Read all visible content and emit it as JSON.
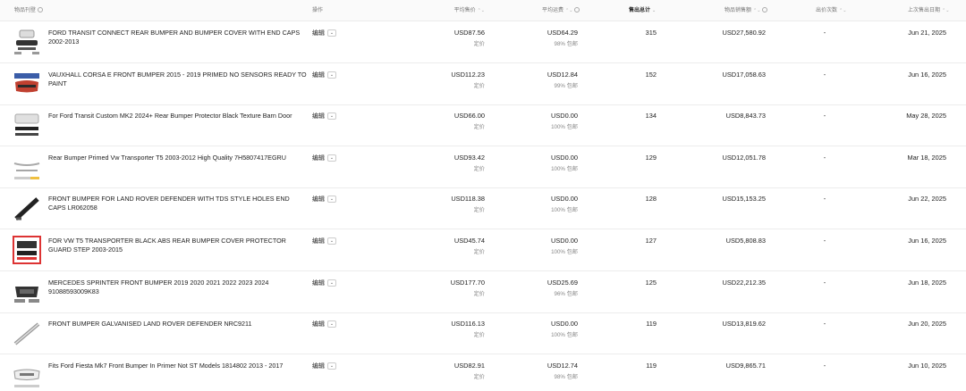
{
  "header": {
    "item": "物品刊登",
    "action": "操作",
    "avg_price": "平均售价",
    "avg_shipping": "平均运费",
    "total_sold": "售出总计",
    "item_sales": "物品销售额",
    "views": "出价次数",
    "last_sold": "上次售出日期",
    "sort_desc_glyph": "⌄",
    "sort_glyph": "⌃⌄"
  },
  "rows": [
    {
      "title": "FORD TRANSIT CONNECT REAR BUMPER AND BUMPER COVER WITH END CAPS 2002-2013",
      "action": "编辑",
      "avg_price": "USD87.56",
      "price_type": "定价",
      "avg_shipping": "USD64.29",
      "shipping_note": "98% 包邮",
      "sold": "315",
      "sales": "USD27,580.92",
      "bids": "-",
      "date": "Jun 21, 2025",
      "thumb": "rear-bumper-cover"
    },
    {
      "title": "VAUXHALL CORSA E FRONT BUMPER 2015 - 2019 PRIMED NO SENSORS READY TO PAINT",
      "action": "编辑",
      "avg_price": "USD112.23",
      "price_type": "定价",
      "avg_shipping": "USD12.84",
      "shipping_note": "99% 包邮",
      "sold": "152",
      "sales": "USD17,058.63",
      "bids": "-",
      "date": "Jun 16, 2025",
      "thumb": "front-bumper-primed"
    },
    {
      "title": "For Ford Transit Custom MK2 2024+ Rear Bumper Protector Black Texture Barn Door",
      "action": "编辑",
      "avg_price": "USD66.00",
      "price_type": "定价",
      "avg_shipping": "USD0.00",
      "shipping_note": "100% 包邮",
      "sold": "134",
      "sales": "USD8,843.73",
      "bids": "-",
      "date": "May 28, 2025",
      "thumb": "bumper-protector"
    },
    {
      "title": "Rear Bumper Primed Vw Transporter T5 2003-2012 High Quality 7H5807417EGRU",
      "action": "编辑",
      "avg_price": "USD93.42",
      "price_type": "定价",
      "avg_shipping": "USD0.00",
      "shipping_note": "100% 包邮",
      "sold": "129",
      "sales": "USD12,051.78",
      "bids": "-",
      "date": "Mar 18, 2025",
      "thumb": "rear-bumper-primed"
    },
    {
      "title": "FRONT BUMPER FOR LAND ROVER DEFENDER WITH TDS STYLE HOLES END CAPS LR062058",
      "action": "编辑",
      "avg_price": "USD118.38",
      "price_type": "定价",
      "avg_shipping": "USD0.00",
      "shipping_note": "100% 包邮",
      "sold": "128",
      "sales": "USD15,153.25",
      "bids": "-",
      "date": "Jun 22, 2025",
      "thumb": "black-bar-bumper"
    },
    {
      "title": "FOR VW T5 TRANSPORTER BLACK ABS REAR BUMPER COVER PROTECTOR GUARD STEP 2003-2015",
      "action": "编辑",
      "avg_price": "USD45.74",
      "price_type": "定价",
      "avg_shipping": "USD0.00",
      "shipping_note": "100% 包邮",
      "sold": "127",
      "sales": "USD5,808.83",
      "bids": "-",
      "date": "Jun 16, 2025",
      "thumb": "red-framed-protector"
    },
    {
      "title": "MERCEDES SPRINTER FRONT BUMPER 2019 2020 2021 2022 2023 2024 91088593009K83",
      "action": "编辑",
      "avg_price": "USD177.70",
      "price_type": "定价",
      "avg_shipping": "USD25.69",
      "shipping_note": "96% 包邮",
      "sold": "125",
      "sales": "USD22,212.35",
      "bids": "-",
      "date": "Jun 18, 2025",
      "thumb": "sprinter-bumper"
    },
    {
      "title": "FRONT BUMPER GALVANISED LAND ROVER DEFENDER NRC9211",
      "action": "编辑",
      "avg_price": "USD116.13",
      "price_type": "定价",
      "avg_shipping": "USD0.00",
      "shipping_note": "100% 包邮",
      "sold": "119",
      "sales": "USD13,819.62",
      "bids": "-",
      "date": "Jun 20, 2025",
      "thumb": "galvanised-bar"
    },
    {
      "title": "Fits Ford Fiesta Mk7 Front Bumper In Primer Not ST Models 1814802 2013 - 2017",
      "action": "编辑",
      "avg_price": "USD82.91",
      "price_type": "定价",
      "avg_shipping": "USD12.74",
      "shipping_note": "98% 包邮",
      "sold": "119",
      "sales": "USD9,865.71",
      "bids": "-",
      "date": "Jun 10, 2025",
      "thumb": "fiesta-bumper"
    }
  ]
}
